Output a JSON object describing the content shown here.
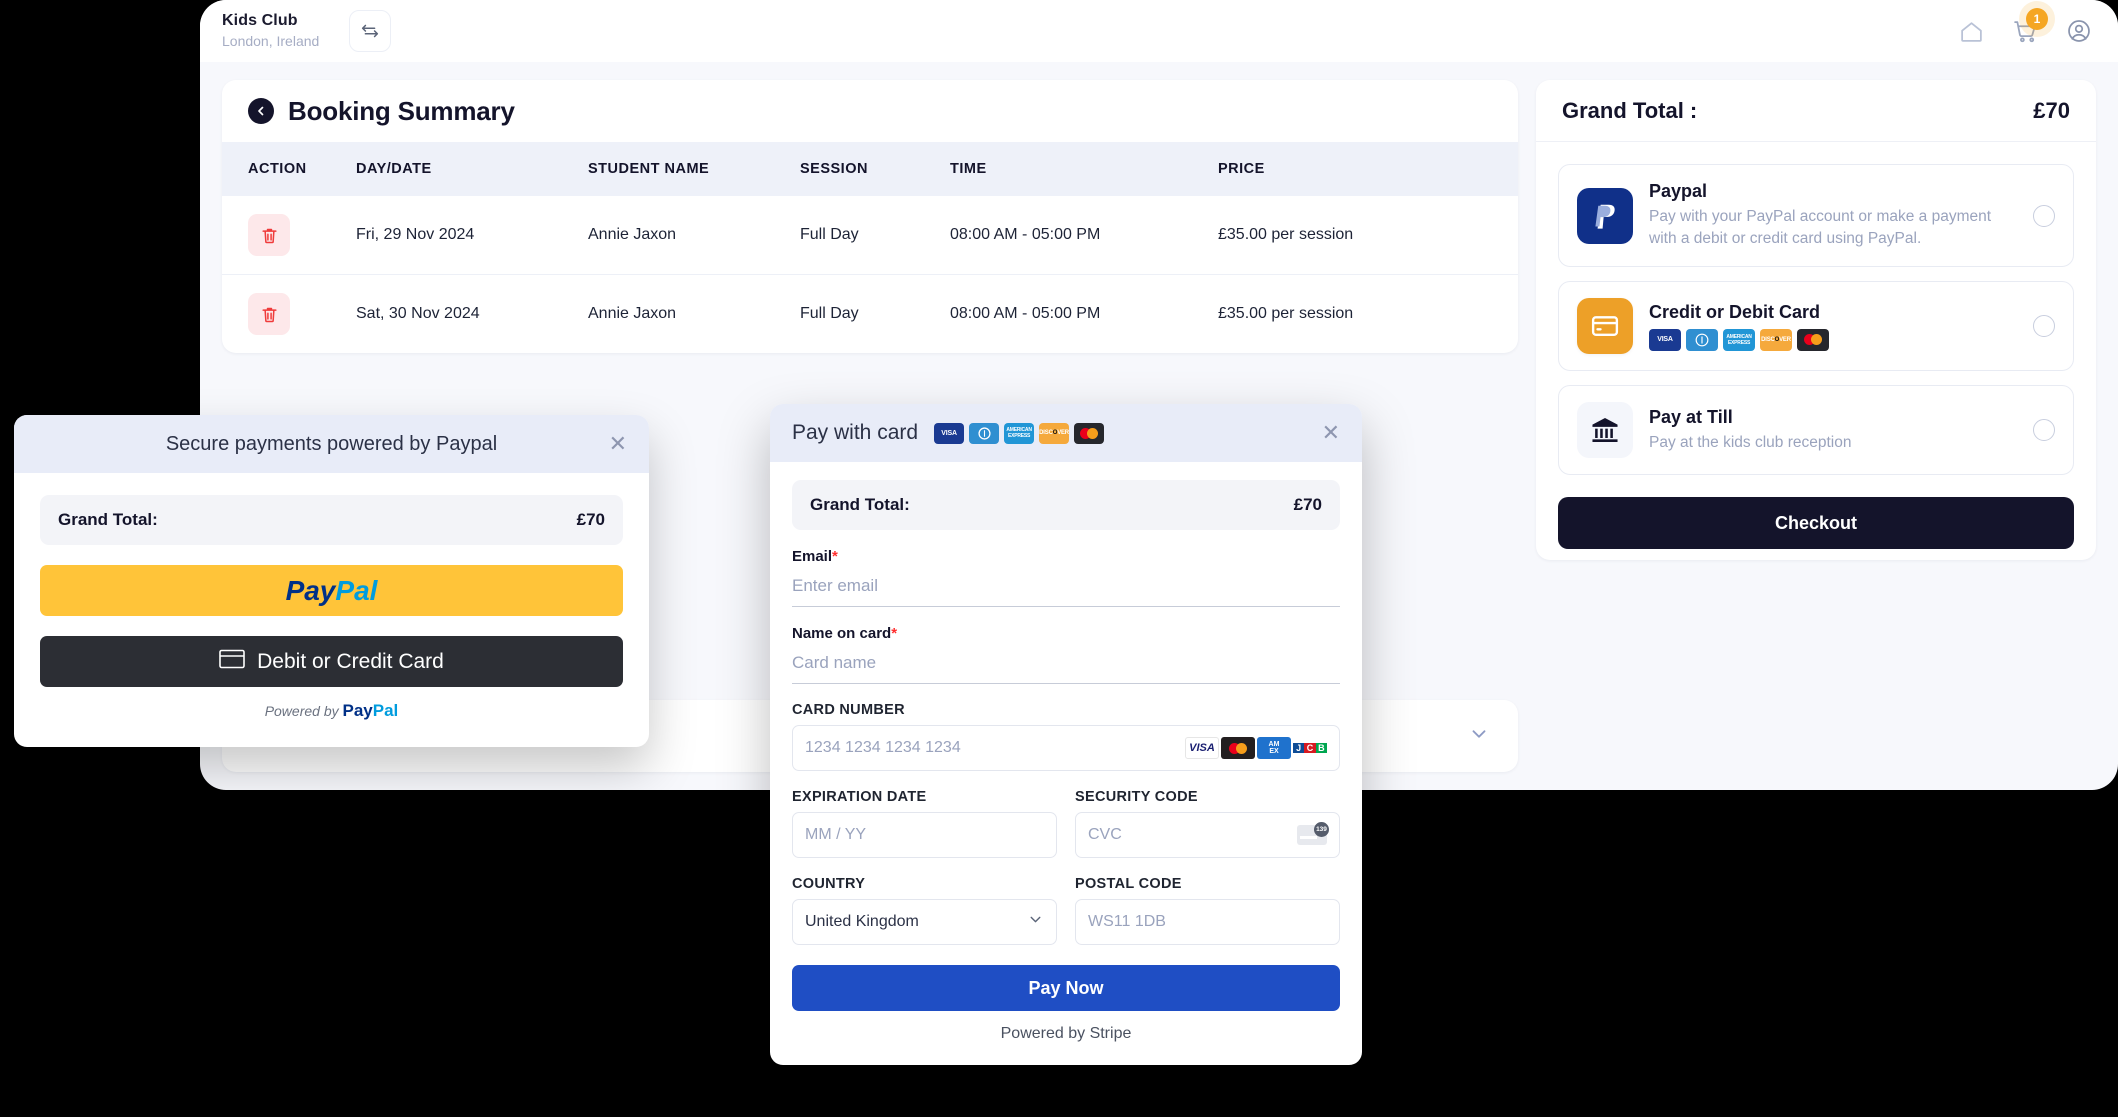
{
  "header": {
    "brand_name": "Kids Club",
    "brand_location": "London, Ireland",
    "swap_icon": "swap-arrows-icon",
    "home_icon": "home-icon",
    "cart_icon": "cart-icon",
    "cart_badge": "1",
    "account_icon": "account-circle-icon"
  },
  "booking_summary": {
    "back_icon": "chevron-left-icon",
    "title": "Booking Summary",
    "columns": [
      "ACTION",
      "DAY/DATE",
      "STUDENT NAME",
      "SESSION",
      "TIME",
      "PRICE"
    ],
    "rows": [
      {
        "action_icon": "trash-icon",
        "day_date": "Fri, 29 Nov 2024",
        "student_name": "Annie Jaxon",
        "session": "Full Day",
        "time": "08:00 AM - 05:00 PM",
        "price": "£35.00 per session"
      },
      {
        "action_icon": "trash-icon",
        "day_date": "Sat, 30 Nov 2024",
        "student_name": "Annie Jaxon",
        "session": "Full Day",
        "time": "08:00 AM - 05:00 PM",
        "price": "£35.00 per session"
      }
    ]
  },
  "accordion": {
    "label": "",
    "chevron_icon": "chevron-down-icon"
  },
  "payment_panel": {
    "grand_total_label": "Grand Total :",
    "grand_total_value": "£70",
    "methods": [
      {
        "icon": "paypal-icon",
        "title": "Paypal",
        "description": "Pay with your PayPal account or make a payment with a debit or credit card using PayPal.",
        "selected": false
      },
      {
        "icon": "credit-card-icon",
        "title": "Credit or Debit Card",
        "description": "",
        "brands": [
          "VISA",
          "Diners Club",
          "American Express",
          "Discover",
          "Mastercard"
        ],
        "selected": false
      },
      {
        "icon": "bank-icon",
        "title": "Pay at Till",
        "description": "Pay at the kids club reception",
        "selected": false
      }
    ],
    "checkout_label": "Checkout"
  },
  "paypal_modal": {
    "title": "Secure payments powered by Paypal",
    "close_icon": "close-icon",
    "grand_total_label": "Grand Total:",
    "grand_total_value": "£70",
    "paypal_button": "PayPal",
    "card_button_label": "Debit or Credit Card",
    "card_button_icon": "card-icon",
    "powered_prefix": "Powered by",
    "powered_brand": "PayPal"
  },
  "stripe_modal": {
    "title": "Pay with card",
    "close_icon": "close-icon",
    "header_brands": [
      "VISA",
      "Diners Club",
      "American Express",
      "Discover",
      "Mastercard"
    ],
    "grand_total_label": "Grand Total:",
    "grand_total_value": "£70",
    "email_label": "Email",
    "email_required": "*",
    "email_placeholder": "Enter email",
    "email_value": "",
    "name_label": "Name on card",
    "name_required": "*",
    "name_placeholder": "Card name",
    "name_value": "",
    "card_number_label": "CARD NUMBER",
    "card_number_placeholder": "1234 1234 1234 1234",
    "card_number_value": "",
    "card_brands": [
      "VISA",
      "Mastercard",
      "AMEX",
      "JCB"
    ],
    "expiration_label": "EXPIRATION DATE",
    "expiration_placeholder": "MM / YY",
    "expiration_value": "",
    "security_label": "SECURITY CODE",
    "security_placeholder": "CVC",
    "security_value": "",
    "security_icon": "cvc-card-icon",
    "country_label": "COUNTRY",
    "country_value": "United Kingdom",
    "country_chevron": "chevron-down-icon",
    "postal_label": "POSTAL CODE",
    "postal_placeholder": "WS11 1DB",
    "postal_value": "",
    "pay_now_label": "Pay Now",
    "powered_by": "Powered by Stripe"
  },
  "colors": {
    "accent_blue": "#1f4ec4",
    "paypal_yellow": "#ffc439",
    "paypal_navy": "#103089",
    "card_orange": "#eda028",
    "dark": "#14142b",
    "danger": "#ff2d2d",
    "badge_orange": "#f5a623"
  }
}
